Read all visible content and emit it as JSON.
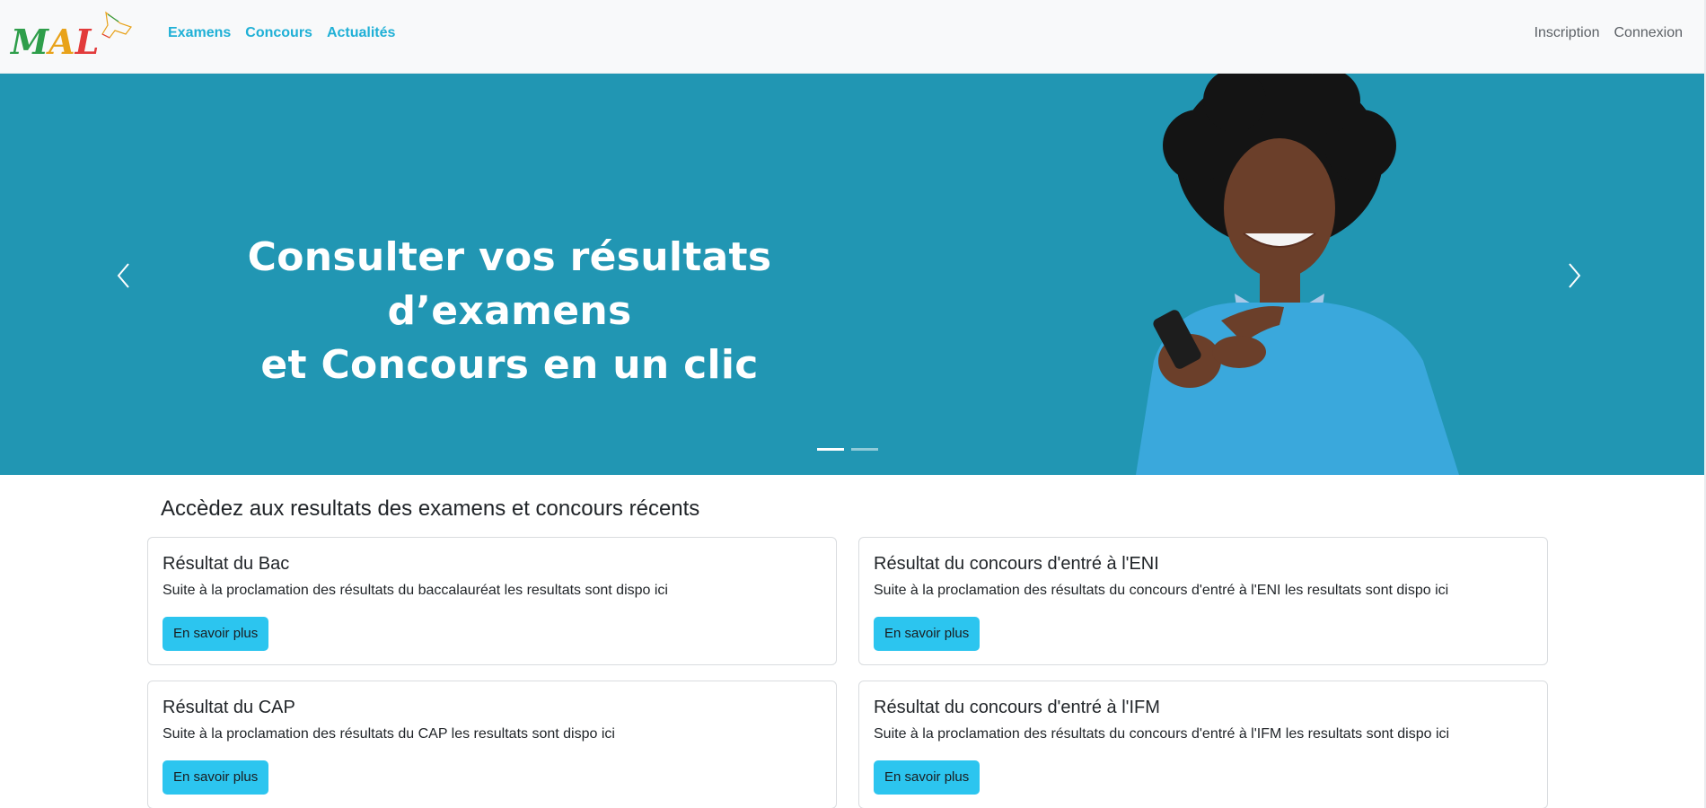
{
  "brand": {
    "logo_text": "MAL"
  },
  "nav": {
    "left": [
      {
        "label": "Examens"
      },
      {
        "label": "Concours"
      },
      {
        "label": "Actualités"
      }
    ],
    "right": [
      {
        "label": "Inscription"
      },
      {
        "label": "Connexion"
      }
    ]
  },
  "hero": {
    "line1": "Consulter vos résultats d’examens",
    "line2": "et Concours en un clic",
    "active_slide": 1,
    "slide_count": 2,
    "background_color": "#2196b3"
  },
  "section": {
    "title": "Accèdez aux resultats des examens et concours récents"
  },
  "cards": [
    {
      "title": "Résultat du Bac",
      "text": "Suite à la proclamation des résultats du baccalauréat les resultats sont dispo ici",
      "button": "En savoir plus"
    },
    {
      "title": "Résultat du concours d'entré à l'ENI",
      "text": "Suite à la proclamation des résultats du concours d'entré à l'ENI les resultats sont dispo ici",
      "button": "En savoir plus"
    },
    {
      "title": "Résultat du CAP",
      "text": "Suite à la proclamation des résultats du CAP les resultats sont dispo ici",
      "button": "En savoir plus"
    },
    {
      "title": "Résultat du concours d'entré à l'IFM",
      "text": "Suite à la proclamation des résultats du concours d'entré à l'IFM les resultats sont dispo ici",
      "button": "En savoir plus"
    }
  ],
  "colors": {
    "accent": "#1fb0d6",
    "button": "#2cc5ef"
  }
}
